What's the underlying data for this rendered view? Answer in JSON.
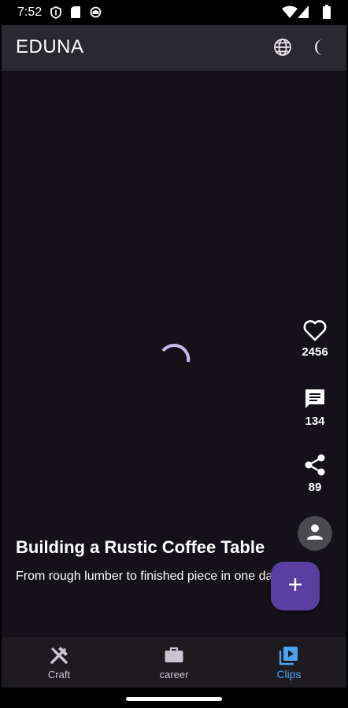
{
  "status_bar": {
    "time": "7:52",
    "icons": [
      "shield-icon",
      "sd-card-icon",
      "app-notification-icon",
      "wifi-icon",
      "cellular-signal-icon",
      "battery-icon"
    ]
  },
  "app_bar": {
    "title": "EDUNA",
    "actions": [
      "globe-icon",
      "dark-mode-icon"
    ]
  },
  "video": {
    "loading": true,
    "title": "Building a Rustic Coffee Table",
    "description": "From rough lumber to finished piece in one da"
  },
  "side_actions": {
    "likes": "2456",
    "comments": "134",
    "shares": "89"
  },
  "fab": {
    "icon": "plus-icon"
  },
  "bottom_nav": {
    "items": [
      {
        "label": "Craft",
        "icon": "tools-icon",
        "active": false
      },
      {
        "label": "career",
        "icon": "briefcase-icon",
        "active": false
      },
      {
        "label": "Clips",
        "icon": "video-library-icon",
        "active": true
      }
    ]
  },
  "colors": {
    "background": "#141218",
    "app_bar": "#2b2930",
    "nav_bar": "#1d1b20",
    "fab": "#5a3fa0",
    "active_nav": "#4aa3f0",
    "spinner": "#c7b8ec"
  }
}
